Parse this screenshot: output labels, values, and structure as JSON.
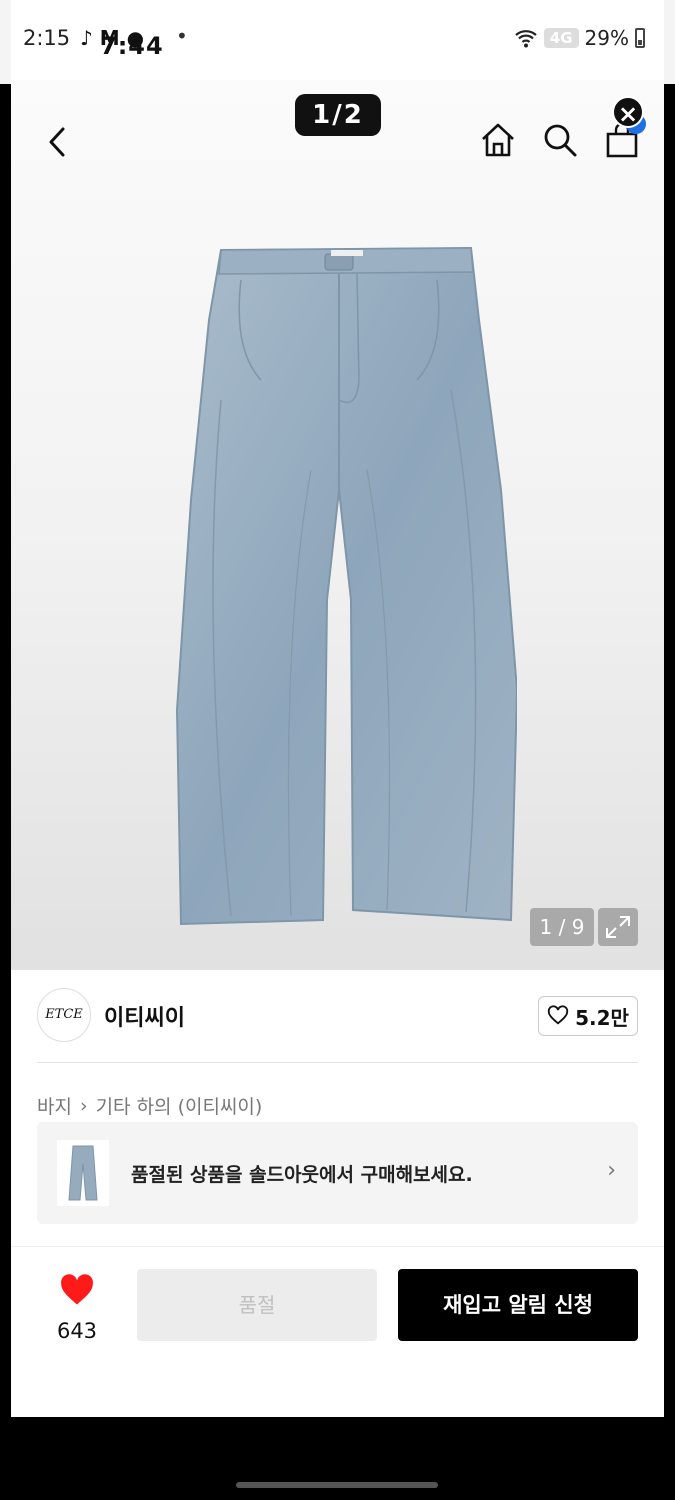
{
  "status_bar": {
    "time": "2:15",
    "overlay_time": "7:44",
    "app_icons": "♪ M ●",
    "dot": "•",
    "network": "4G",
    "battery": "29%"
  },
  "viewer": {
    "story_page": "1/2",
    "image_counter": "1 / 9"
  },
  "brand": {
    "logo_text": "ETCE",
    "name": "이티씨이",
    "likes": "5.2만"
  },
  "breadcrumb": {
    "category": "바지",
    "separator": "›",
    "subcategory": "기타 하의 (이티씨이)"
  },
  "soldout_card": {
    "message": "품절된 상품을 솔드아웃에서 구매해보세요.",
    "arrow": "›"
  },
  "bottom_bar": {
    "wish_count": "643",
    "sold_out_label": "품절",
    "restock_label": "재입고 알림 신청"
  },
  "colors": {
    "accent_heart": "#ff1a1a",
    "cart_badge": "#1f6fe5",
    "primary_button": "#000000"
  }
}
